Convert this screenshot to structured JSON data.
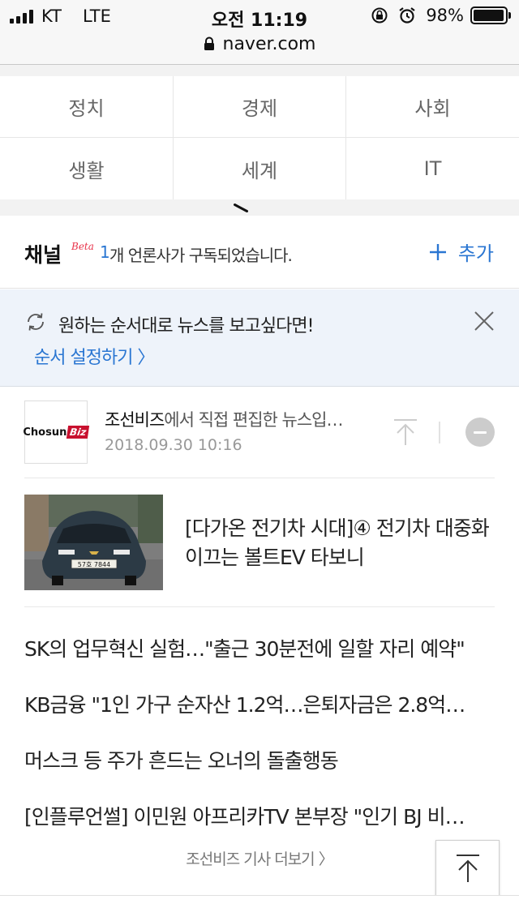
{
  "status_bar": {
    "carrier": "KT",
    "network": "LTE",
    "time": "오전 11:19",
    "battery_percent": "98%",
    "battery_level": 0.98
  },
  "browser": {
    "url": "naver.com"
  },
  "categories": [
    "정치",
    "경제",
    "사회",
    "생활",
    "세계",
    "IT"
  ],
  "channel": {
    "title": "채널",
    "badge": "Beta",
    "count": "1",
    "description": "개 언론사가 구독되었습니다.",
    "add_label": "추가"
  },
  "notice": {
    "text": "원하는 순서대로 뉴스를 보고싶다면!",
    "link": "순서 설정하기 〉"
  },
  "press": {
    "logo_text": "Chosun",
    "logo_badge": "Biz",
    "name": "조선비즈",
    "title_rest": "에서 직접 편집한 뉴스입…",
    "date": "2018.09.30 10:16"
  },
  "headline": {
    "title": "[다가온 전기차 시대]④ 전기차 대중화 이끄는 볼트EV 타보니",
    "plate": "57호 7844"
  },
  "news": [
    "SK의 업무혁신 실험…\"출근 30분전에 일할 자리 예약\"",
    "KB금융 \"1인 가구 순자산 1.2억…은퇴자금은 2.8억…",
    "머스크 등 주가 흔드는 오너의 돌출행동",
    "[인플루언썰] 이민원 아프리카TV 본부장 \"인기 BJ 비…"
  ],
  "more_label": "조선비즈 기사 더보기 〉",
  "colors": {
    "accent": "#2a76d2",
    "notice_bg": "#eef3fa",
    "beta": "#e8334a",
    "logo_red": "#c8102e"
  }
}
